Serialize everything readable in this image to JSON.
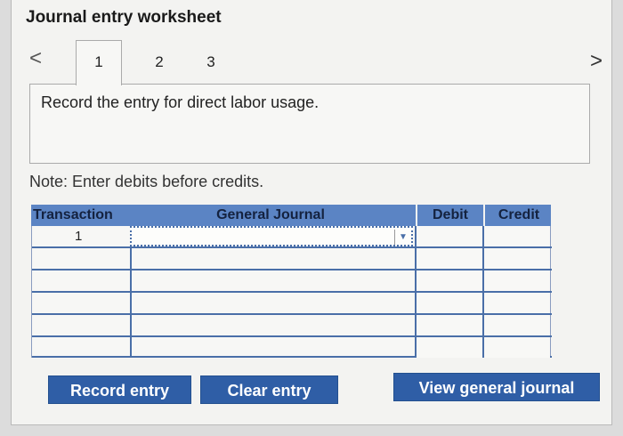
{
  "worksheet": {
    "title": "Journal entry worksheet",
    "nav": {
      "prev_symbol": "<",
      "next_symbol": ">"
    },
    "tabs": [
      {
        "label": "1",
        "active": true
      },
      {
        "label": "2",
        "active": false
      },
      {
        "label": "3",
        "active": false
      }
    ]
  },
  "instruction": "Record the entry for direct labor usage.",
  "note": "Note: Enter debits before credits.",
  "journal": {
    "headers": {
      "transaction": "Transaction",
      "general_journal": "General Journal",
      "debit": "Debit",
      "credit": "Credit"
    },
    "rows": [
      {
        "transaction": "1",
        "account": "",
        "debit": "",
        "credit": ""
      },
      {
        "transaction": "",
        "account": "",
        "debit": "",
        "credit": ""
      },
      {
        "transaction": "",
        "account": "",
        "debit": "",
        "credit": ""
      },
      {
        "transaction": "",
        "account": "",
        "debit": "",
        "credit": ""
      },
      {
        "transaction": "",
        "account": "",
        "debit": "",
        "credit": ""
      },
      {
        "transaction": "",
        "account": "",
        "debit": "",
        "credit": ""
      }
    ]
  },
  "buttons": {
    "record_entry": "Record entry",
    "clear_entry": "Clear entry",
    "view_general_journal": "View general journal"
  },
  "colors": {
    "header_blue": "#5b84c4",
    "button_blue": "#2f5ea6",
    "grid_line": "#4a6fa8"
  }
}
